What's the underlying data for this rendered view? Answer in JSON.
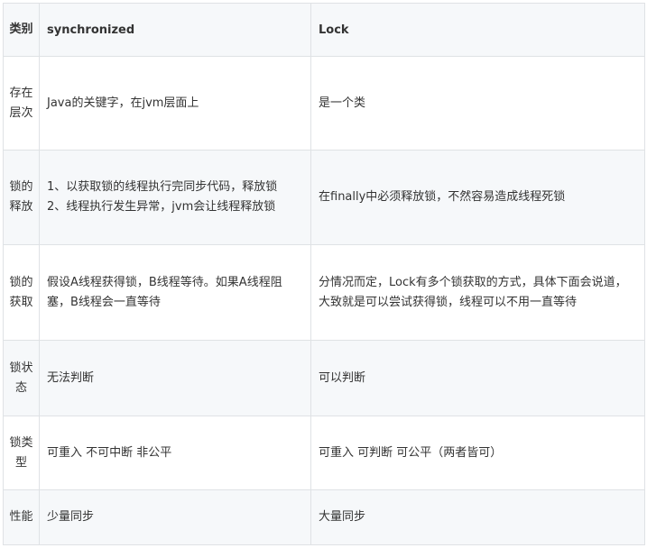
{
  "table": {
    "headers": [
      "类别",
      "synchronized",
      "Lock"
    ],
    "rows": [
      {
        "category": "存在层次",
        "sync": [
          "Java的关键字，在jvm层面上"
        ],
        "lock": [
          "是一个类"
        ]
      },
      {
        "category": "锁的释放",
        "sync": [
          "1、以获取锁的线程执行完同步代码，释放锁",
          "2、线程执行发生异常，jvm会让线程释放锁"
        ],
        "lock": [
          "在finally中必须释放锁，不然容易造成线程死锁"
        ]
      },
      {
        "category": "锁的获取",
        "sync": [
          "假设A线程获得锁，B线程等待。如果A线程阻塞，B线程会一直等待"
        ],
        "lock": [
          "分情况而定，Lock有多个锁获取的方式，具体下面会说道，大致就是可以尝试获得锁，线程可以不用一直等待"
        ]
      },
      {
        "category": "锁状态",
        "sync": [
          "无法判断"
        ],
        "lock": [
          "可以判断"
        ]
      },
      {
        "category": "锁类型",
        "sync": [
          "可重入 不可中断 非公平"
        ],
        "lock": [
          "可重入 可判断 可公平（两者皆可）"
        ]
      },
      {
        "category": "性能",
        "sync": [
          "少量同步"
        ],
        "lock": [
          "大量同步"
        ]
      }
    ]
  }
}
